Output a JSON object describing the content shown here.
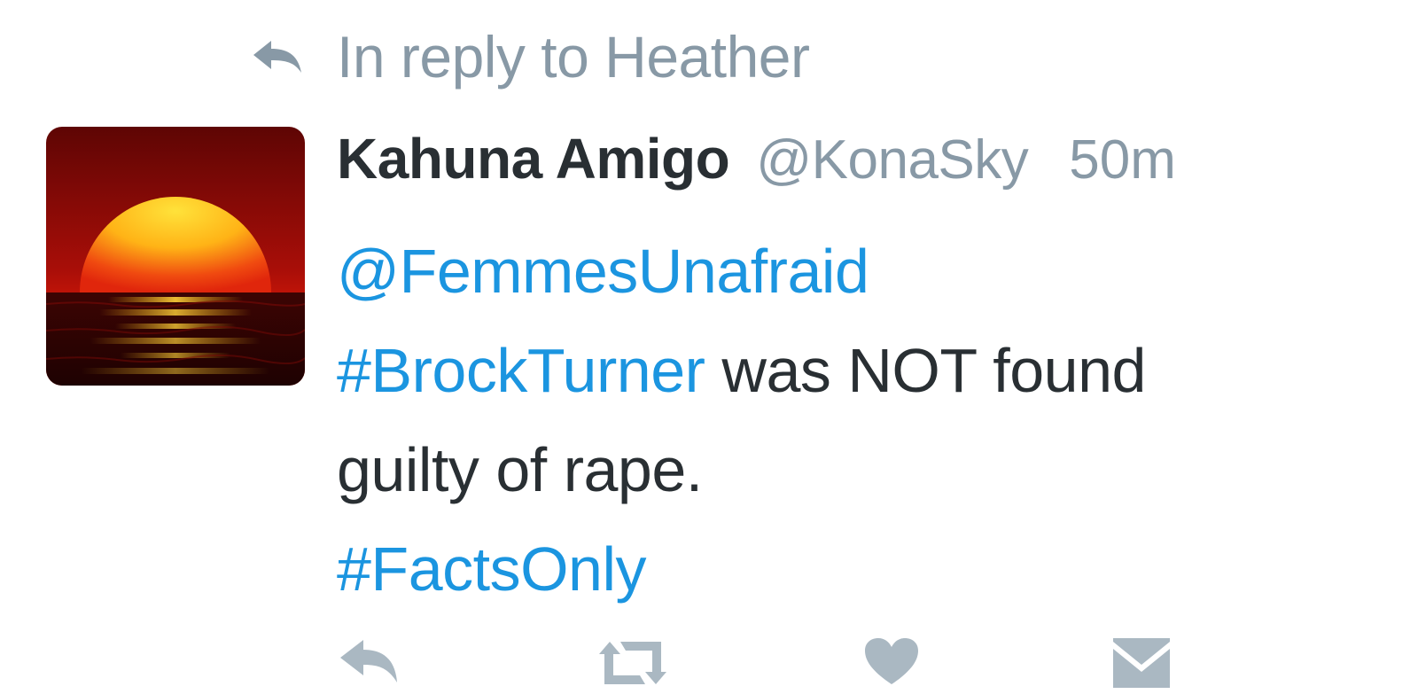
{
  "reply_context": {
    "icon": "reply-arrow-icon",
    "text": "In reply to Heather"
  },
  "tweet": {
    "avatar": {
      "icon": "sunset-avatar",
      "colors": [
        "#7a0a06",
        "#e0200e",
        "#ffd21a"
      ]
    },
    "display_name": "Kahuna Amigo",
    "handle": "@KonaSky",
    "timestamp": "50m",
    "body": {
      "mention": "@FemmesUnafraid",
      "hashtag1": "#BrockTurner",
      "text1": " was NOT found",
      "text2": "guilty of rape.",
      "hashtag2": "#FactsOnly"
    },
    "actions": [
      {
        "name": "reply",
        "icon": "reply-icon"
      },
      {
        "name": "retweet",
        "icon": "retweet-icon"
      },
      {
        "name": "like",
        "icon": "heart-icon"
      },
      {
        "name": "direct-message",
        "icon": "envelope-icon"
      }
    ]
  },
  "colors": {
    "link": "#1b95e0",
    "muted": "#8899a6",
    "text": "#292f33",
    "icon": "#aab8c2"
  }
}
